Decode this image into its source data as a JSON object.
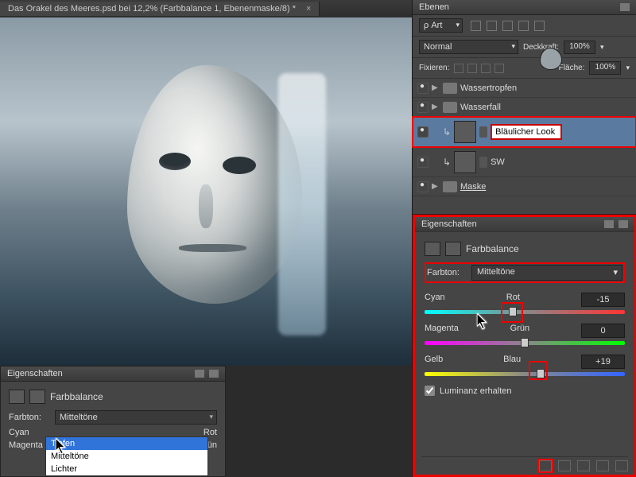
{
  "document": {
    "tab_title": "Das Orakel des Meeres.psd bei 12,2% (Farbbalance 1, Ebenenmaske/8) *"
  },
  "layers_panel": {
    "title": "Ebenen",
    "filter_label": "Art",
    "blend_mode": "Normal",
    "opacity_label": "Deckkraft:",
    "opacity_value": "100%",
    "lock_label": "Fixieren:",
    "fill_label": "Fläche:",
    "fill_value": "100%",
    "layers": [
      {
        "name": "Wassertropfen",
        "type": "group"
      },
      {
        "name": "Wasserfall",
        "type": "group"
      },
      {
        "name": "Bläulicher Look",
        "type": "adjustment",
        "editing": true,
        "active": true
      },
      {
        "name": "SW",
        "type": "adjustment"
      },
      {
        "name": "Maske",
        "type": "group",
        "underline": true
      }
    ]
  },
  "properties_right": {
    "title": "Eigenschaften",
    "adj_name": "Farbbalance",
    "tone_label": "Farbton:",
    "tone_value": "Mitteltöne",
    "sliders": {
      "cyan": {
        "left": "Cyan",
        "right": "Rot",
        "value": "-15",
        "pos": 44
      },
      "magenta": {
        "left": "Magenta",
        "right": "Grün",
        "value": "0",
        "pos": 50
      },
      "yellow": {
        "left": "Gelb",
        "right": "Blau",
        "value": "+19",
        "pos": 58
      }
    },
    "preserve_lum": "Luminanz erhalten"
  },
  "properties_left": {
    "title": "Eigenschaften",
    "adj_name": "Farbbalance",
    "tone_label": "Farbton:",
    "tone_value": "Mitteltöne",
    "dropdown_options": [
      "Tiefen",
      "Mitteltöne",
      "Lichter"
    ],
    "sliders": {
      "cyan_l": "Cyan",
      "cyan_r": "Rot",
      "mag_l": "Magenta",
      "mag_r": "Grün"
    }
  }
}
